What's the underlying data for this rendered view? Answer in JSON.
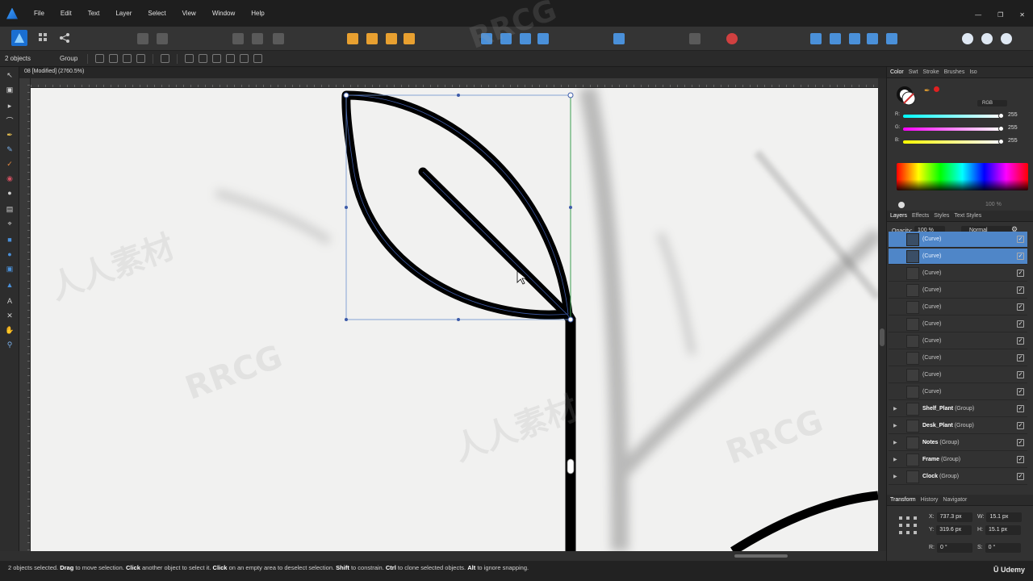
{
  "menu": {
    "items": [
      "File",
      "Edit",
      "Text",
      "Layer",
      "Select",
      "View",
      "Window",
      "Help"
    ]
  },
  "context": {
    "selection_count": "2 objects",
    "group_label": "Group"
  },
  "document": {
    "tab_title": "08 [Modified] (2760.5%)"
  },
  "right_panel": {
    "color_tabs": [
      "Color",
      "Swt",
      "Stroke",
      "Brushes",
      "Iso"
    ],
    "color_model": "RGB",
    "r_label": "R:",
    "g_label": "G:",
    "b_label": "B:",
    "r_value": "255",
    "g_value": "255",
    "b_value": "255",
    "opacity_readout": "100 %",
    "layer_tabs": [
      "Layers",
      "Effects",
      "Styles",
      "Text Styles"
    ],
    "opacity_label": "Opacity:",
    "opacity_value": "100 %",
    "blend_mode": "Normal",
    "layers": [
      {
        "name": "(Curve)",
        "type": "",
        "selected": true
      },
      {
        "name": "(Curve)",
        "type": "",
        "selected": true
      },
      {
        "name": "(Curve)",
        "type": "",
        "selected": false
      },
      {
        "name": "(Curve)",
        "type": "",
        "selected": false
      },
      {
        "name": "(Curve)",
        "type": "",
        "selected": false
      },
      {
        "name": "(Curve)",
        "type": "",
        "selected": false
      },
      {
        "name": "(Curve)",
        "type": "",
        "selected": false
      },
      {
        "name": "(Curve)",
        "type": "",
        "selected": false
      },
      {
        "name": "(Curve)",
        "type": "",
        "selected": false
      },
      {
        "name": "(Curve)",
        "type": "",
        "selected": false
      },
      {
        "name": "Shelf_Plant",
        "type": "(Group)",
        "selected": false
      },
      {
        "name": "Desk_Plant",
        "type": "(Group)",
        "selected": false
      },
      {
        "name": "Notes",
        "type": "(Group)",
        "selected": false
      },
      {
        "name": "Frame",
        "type": "(Group)",
        "selected": false
      },
      {
        "name": "Clock",
        "type": "(Group)",
        "selected": false
      }
    ],
    "transform_tabs": [
      "Transform",
      "History",
      "Navigator"
    ],
    "x_label": "X:",
    "x_value": "737.3 px",
    "y_label": "Y:",
    "y_value": "319.6 px",
    "w_label": "W:",
    "w_value": "15.1 px",
    "h_label": "H:",
    "h_value": "15.1 px",
    "r_rot_label": "R:",
    "r_rot_value": "0 °",
    "s_label": "S:",
    "s_value": "0 °"
  },
  "status": {
    "prefix": "2 objects selected.",
    "drag": "Drag",
    "drag_text": "to move selection.",
    "click": "Click",
    "click_text": "another object to select it.",
    "click2": "Click",
    "click2_text": "on an empty area to deselect selection.",
    "shift": "Shift",
    "shift_text": "to constrain.",
    "ctrl": "Ctrl",
    "ctrl_text": "to clone selected objects.",
    "alt": "Alt",
    "alt_text": "to ignore snapping."
  },
  "branding": {
    "udemy": "Udemy",
    "watermark_rrcg": "RRCG",
    "watermark_cn": "人人素材"
  }
}
